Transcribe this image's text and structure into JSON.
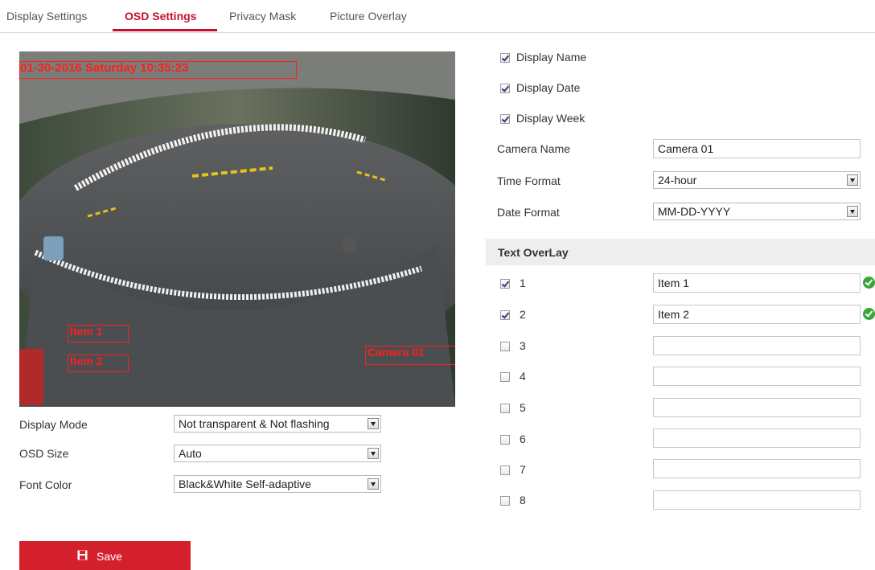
{
  "tabs": [
    {
      "label": "Display Settings",
      "active": false
    },
    {
      "label": "OSD Settings",
      "active": true
    },
    {
      "label": "Privacy Mask",
      "active": false
    },
    {
      "label": "Picture Overlay",
      "active": false
    }
  ],
  "preview": {
    "osd_datetime": "01-30-2016 Saturday 10:35:23",
    "overlay_item1": "Item 1",
    "overlay_item2": "Item 2",
    "camera_name": "Camera 01",
    "osd_color": "#ff1e1e"
  },
  "left_settings": {
    "display_mode": {
      "label": "Display Mode",
      "value": "Not transparent & Not flashing"
    },
    "osd_size": {
      "label": "OSD Size",
      "value": "Auto"
    },
    "font_color": {
      "label": "Font Color",
      "value": "Black&White Self-adaptive"
    }
  },
  "save_label": "Save",
  "display": {
    "name": {
      "label": "Display Name",
      "checked": true
    },
    "date": {
      "label": "Display Date",
      "checked": true
    },
    "week": {
      "label": "Display Week",
      "checked": true
    }
  },
  "camera_name": {
    "label": "Camera Name",
    "value": "Camera 01"
  },
  "time_format": {
    "label": "Time Format",
    "value": "24-hour"
  },
  "date_format": {
    "label": "Date Format",
    "value": "MM-DD-YYYY"
  },
  "text_overlay": {
    "title": "Text OverLay",
    "items": [
      {
        "num": "1",
        "checked": true,
        "value": "Item 1",
        "valid": true
      },
      {
        "num": "2",
        "checked": true,
        "value": "Item 2",
        "valid": true
      },
      {
        "num": "3",
        "checked": false,
        "value": "",
        "valid": false
      },
      {
        "num": "4",
        "checked": false,
        "value": "",
        "valid": false
      },
      {
        "num": "5",
        "checked": false,
        "value": "",
        "valid": false
      },
      {
        "num": "6",
        "checked": false,
        "value": "",
        "valid": false
      },
      {
        "num": "7",
        "checked": false,
        "value": "",
        "valid": false
      },
      {
        "num": "8",
        "checked": false,
        "value": "",
        "valid": false
      }
    ]
  },
  "colors": {
    "accent": "#c8102e",
    "save_button": "#d4202c",
    "valid": "#3aa53a"
  }
}
